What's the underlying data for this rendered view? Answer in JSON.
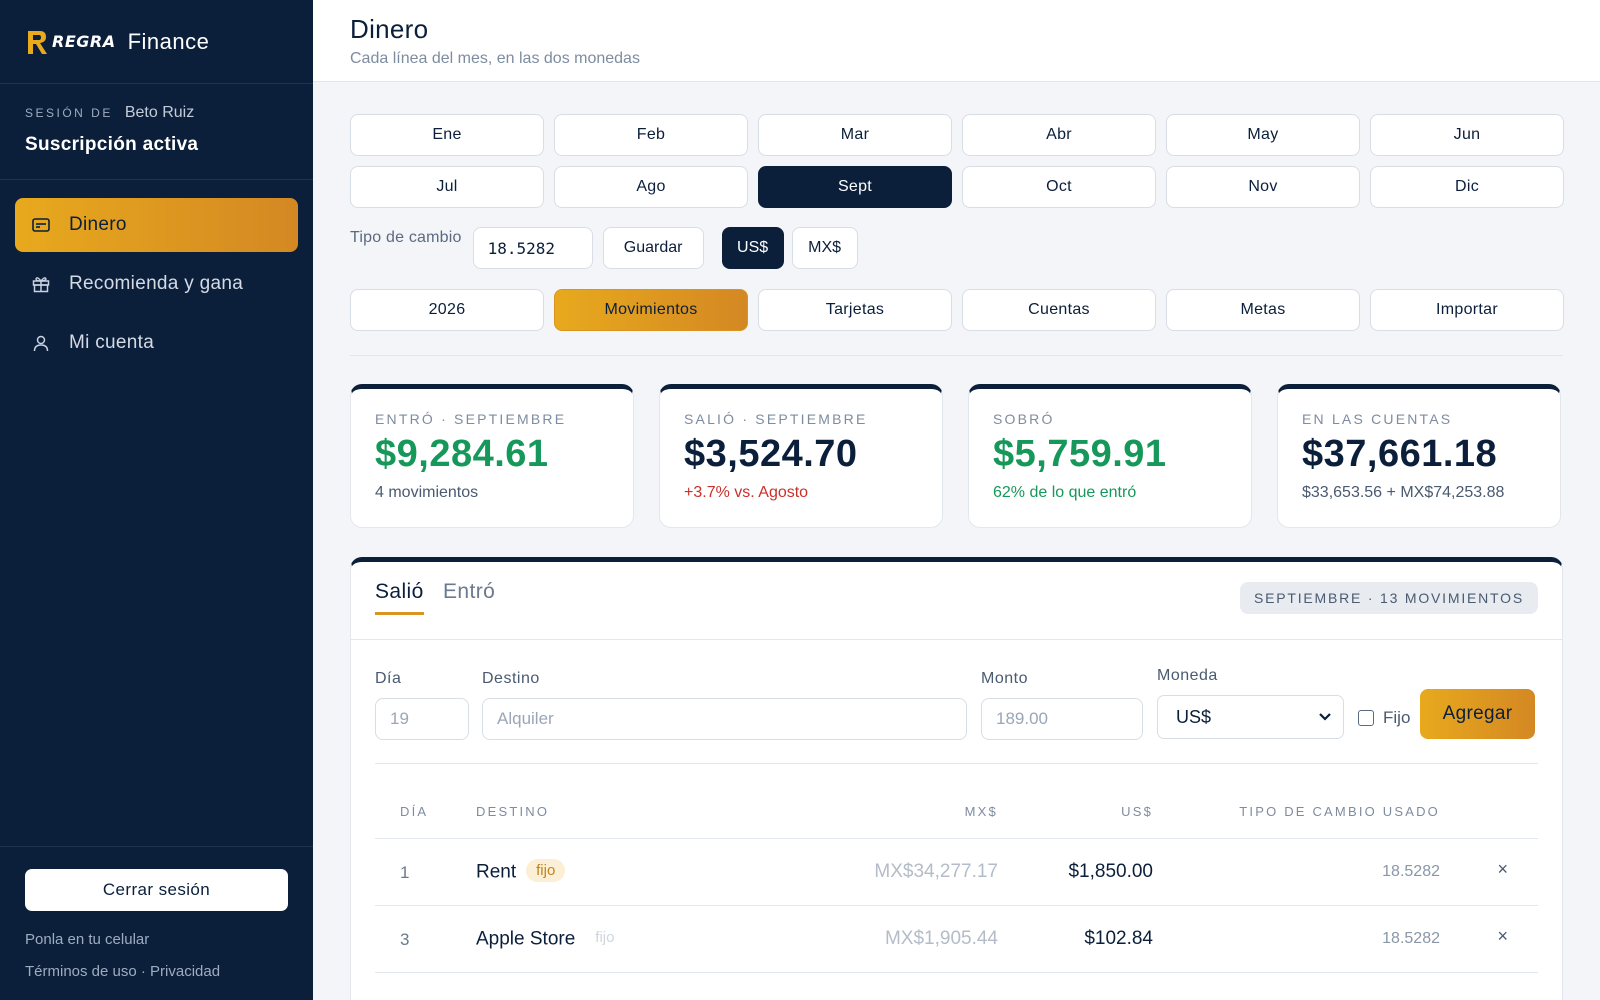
{
  "sidebar": {
    "brand_name": "REGRA",
    "brand_product": "Finance",
    "session_label": "SESIÓN DE",
    "session_user": "Beto Ruiz",
    "subscription_status": "Suscripción activa",
    "nav": [
      {
        "label": "Dinero",
        "icon": "card-icon",
        "active": true
      },
      {
        "label": "Recomienda y gana",
        "icon": "gift-icon",
        "active": false
      },
      {
        "label": "Mi cuenta",
        "icon": "user-icon",
        "active": false
      }
    ],
    "logout_label": "Cerrar sesión",
    "footer_install": "Ponla en tu celular",
    "footer_legal": "Términos de uso · Privacidad"
  },
  "header": {
    "title": "Dinero",
    "subtitle": "Cada línea del mes, en las dos monedas"
  },
  "months": [
    "Ene",
    "Feb",
    "Mar",
    "Abr",
    "May",
    "Jun",
    "Jul",
    "Ago",
    "Sept",
    "Oct",
    "Nov",
    "Dic"
  ],
  "selected_month": "Sept",
  "exchange": {
    "label": "Tipo de cambio",
    "value": "18.5282",
    "save_label": "Guardar",
    "currency_options": [
      "US$",
      "MX$"
    ],
    "selected_currency": "US$"
  },
  "sections": [
    "2026",
    "Movimientos",
    "Tarjetas",
    "Cuentas",
    "Metas",
    "Importar"
  ],
  "selected_section": "Movimientos",
  "summary_cards": [
    {
      "label": "ENTRÓ · SEPTIEMBRE",
      "value": "$9,284.61",
      "note": "4 movimientos"
    },
    {
      "label": "SALIÓ · SEPTIEMBRE",
      "value": "$3,524.70",
      "note": "+3.7% vs. Agosto"
    },
    {
      "label": "SOBRÓ",
      "value": "$5,759.91",
      "note": "62% de lo que entró"
    },
    {
      "label": "EN LAS CUENTAS",
      "value": "$37,661.18",
      "note": "$33,653.56 + MX$74,253.88"
    }
  ],
  "panel": {
    "tab_active": "Salió",
    "tab_inactive": "Entró",
    "badge": "SEPTIEMBRE · 13 MOVIMIENTOS",
    "form": {
      "day_label": "Día",
      "day_placeholder": "19",
      "dest_label": "Destino",
      "dest_placeholder": "Alquiler",
      "amount_label": "Monto",
      "amount_placeholder": "189.00",
      "currency_label": "Moneda",
      "currency_value": "US$",
      "fixed_label": "Fijo",
      "add_label": "Agregar"
    },
    "table": {
      "headers": [
        "DÍA",
        "DESTINO",
        "MX$",
        "US$",
        "TIPO DE CAMBIO USADO"
      ],
      "rows": [
        {
          "day": "1",
          "dest": "Rent",
          "tag": "fijo",
          "mx": "MX$34,277.17",
          "us": "$1,850.00",
          "fx": "18.5282"
        },
        {
          "day": "3",
          "dest": "Apple Store",
          "tag": "fijo",
          "mx": "MX$1,905.44",
          "us": "$102.84",
          "fx": "18.5282"
        }
      ],
      "delete_symbol": "×"
    }
  },
  "colors": {
    "navy": "#0b1f3a",
    "gold": "#e8a91d",
    "green": "#16985a",
    "red": "#c9302c"
  }
}
